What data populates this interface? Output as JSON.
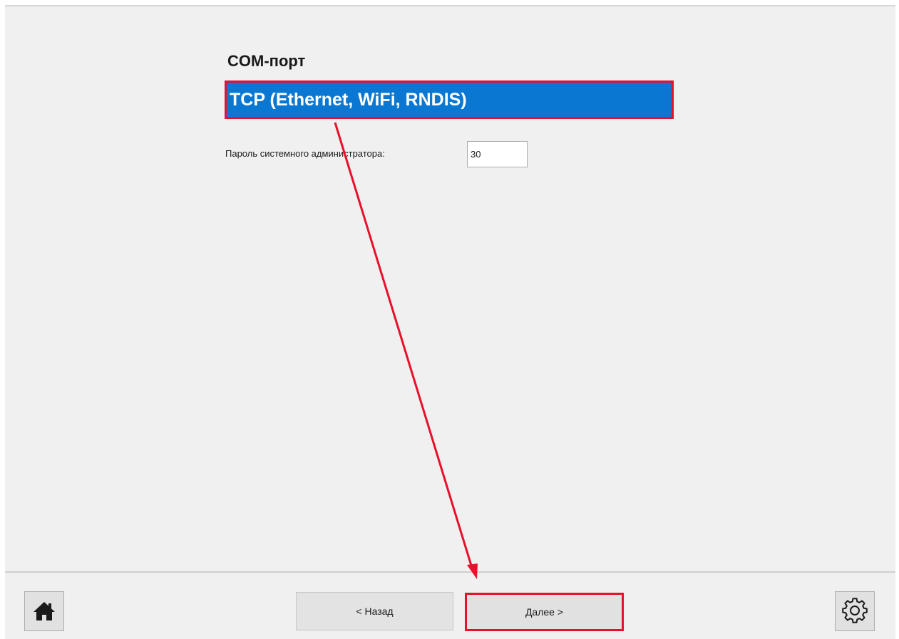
{
  "wizard": {
    "section_title": "COM-порт",
    "connection_option": "TCP (Ethernet, WiFi, RNDIS)",
    "admin_password_label": "Пароль системного администратора:",
    "admin_password_value": "30"
  },
  "footer": {
    "home_icon": "home-icon",
    "back_label": "< Назад",
    "next_label": "Далее >",
    "settings_icon": "gear-icon"
  },
  "annotations": {
    "highlight_color": "#e8102a",
    "selection_color": "#0a78d2"
  }
}
